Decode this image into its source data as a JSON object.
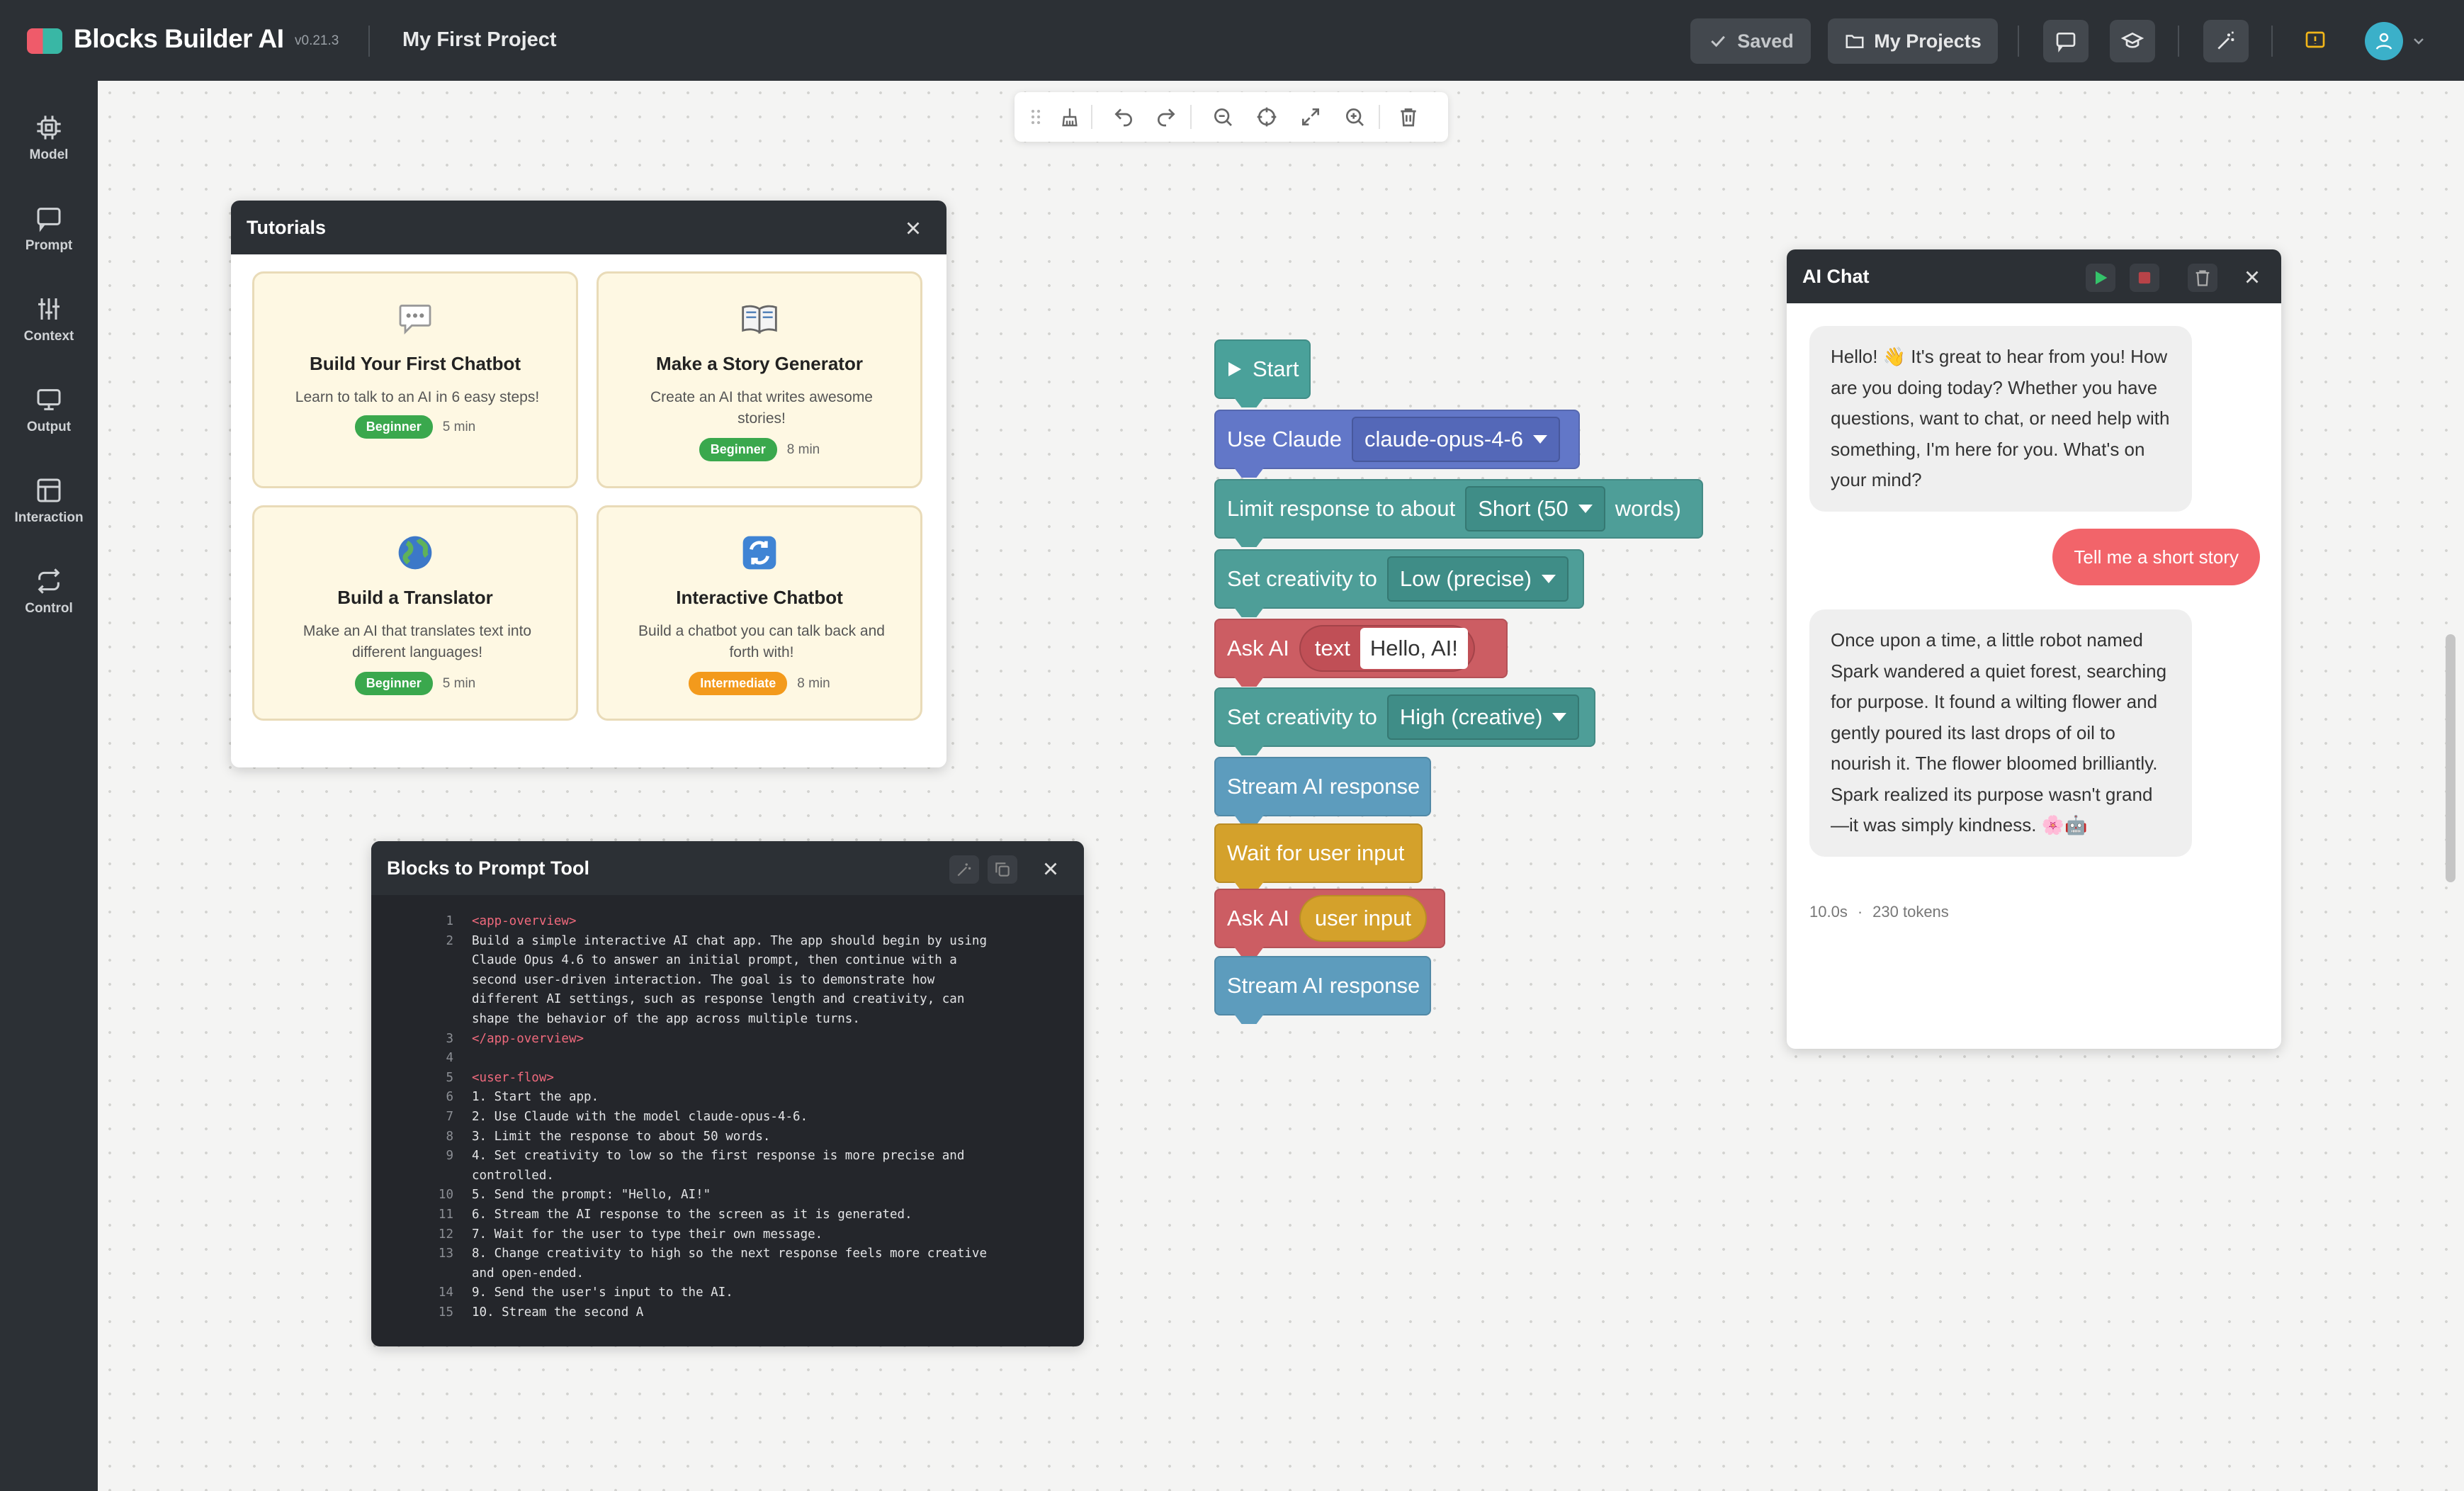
{
  "app": {
    "name": "Blocks Builder AI",
    "version": "v0.21.3",
    "project_name": "My First Project"
  },
  "topbar": {
    "saved_label": "Saved",
    "projects_label": "My Projects"
  },
  "sidebar": {
    "items": [
      {
        "label": "Model",
        "icon": "chip-icon"
      },
      {
        "label": "Prompt",
        "icon": "message-icon"
      },
      {
        "label": "Context",
        "icon": "sliders-icon"
      },
      {
        "label": "Output",
        "icon": "monitor-icon"
      },
      {
        "label": "Interaction",
        "icon": "layout-icon"
      },
      {
        "label": "Control",
        "icon": "repeat-icon"
      }
    ]
  },
  "tutorials": {
    "title": "Tutorials",
    "cards": [
      {
        "title": "Build Your First Chatbot",
        "desc": "Learn to talk to an AI in 6 easy steps!",
        "level": "Beginner",
        "time": "5 min",
        "icon": "speech-bubble-icon"
      },
      {
        "title": "Make a Story Generator",
        "desc": "Create an AI that writes awesome stories!",
        "level": "Beginner",
        "time": "8 min",
        "icon": "book-icon"
      },
      {
        "title": "Build a Translator",
        "desc": "Make an AI that translates text into different languages!",
        "level": "Beginner",
        "time": "5 min",
        "icon": "globe-icon"
      },
      {
        "title": "Interactive Chatbot",
        "desc": "Build a chatbot you can talk back and forth with!",
        "level": "Intermediate",
        "time": "8 min",
        "icon": "cycle-arrows-icon"
      }
    ]
  },
  "blocks_to_prompt": {
    "title": "Blocks to Prompt Tool",
    "lines": [
      {
        "num": "1",
        "text": "<app-overview>"
      },
      {
        "num": "2",
        "text": "Build a simple interactive AI chat app. The app should begin by using"
      },
      {
        "num": "",
        "text": "Claude Opus 4.6 to answer an initial prompt, then continue with a"
      },
      {
        "num": "",
        "text": "second user-driven interaction. The goal is to demonstrate how"
      },
      {
        "num": "",
        "text": "different AI settings, such as response length and creativity, can"
      },
      {
        "num": "",
        "text": "shape the behavior of the app across multiple turns."
      },
      {
        "num": "3",
        "text": "</app-overview>"
      },
      {
        "num": "4",
        "text": ""
      },
      {
        "num": "5",
        "text": "<user-flow>"
      },
      {
        "num": "6",
        "text": "1. Start the app."
      },
      {
        "num": "7",
        "text": "2. Use Claude with the model claude-opus-4-6."
      },
      {
        "num": "8",
        "text": "3. Limit the response to about 50 words."
      },
      {
        "num": "9",
        "text": "4. Set creativity to low so the first response is more precise and"
      },
      {
        "num": "",
        "text": "controlled."
      },
      {
        "num": "10",
        "text": "5. Send the prompt: \"Hello, AI!\""
      },
      {
        "num": "11",
        "text": "6. Stream the AI response to the screen as it is generated."
      },
      {
        "num": "12",
        "text": "7. Wait for the user to type their own message."
      },
      {
        "num": "13",
        "text": "8. Change creativity to high so the next response feels more creative"
      },
      {
        "num": "",
        "text": "and open-ended."
      },
      {
        "num": "14",
        "text": "9. Send the user's input to the AI."
      },
      {
        "num": "15",
        "text": "10. Stream the second A"
      }
    ]
  },
  "blocks": {
    "start": "Start",
    "use_claude": "Use Claude",
    "model_value": "claude-opus-4-6",
    "limit_prefix": "Limit response to about",
    "limit_value": "Short (50",
    "limit_suffix": "words)",
    "creativity_label": "Set creativity to",
    "creativity_low": "Low (precise)",
    "ask_ai": "Ask AI",
    "text_label": "text",
    "prompt_value": "Hello, AI!",
    "creativity_high": "High (creative)",
    "stream": "Stream AI response",
    "wait": "Wait for user input",
    "user_input": "user input"
  },
  "ai_chat": {
    "title": "AI Chat",
    "messages": [
      {
        "role": "ai",
        "text": "Hello! 👋 It's great to hear from you! How are you doing today? Whether you have questions, want to chat, or need help with something, I'm here for you. What's on your mind?"
      },
      {
        "role": "user",
        "text": "Tell me a short story"
      },
      {
        "role": "ai",
        "text": "Once upon a time, a little robot named Spark wandered a quiet forest, searching for purpose. It found a wilting flower and gently poured its last drops of oil to nourish it. The flower bloomed brilliantly. Spark realized its purpose wasn't grand—it was simply kindness. 🌸🤖"
      }
    ],
    "duration": "10.0s",
    "separator": "·",
    "tokens": "230 tokens"
  },
  "colors": {
    "topbar": "#2c3035",
    "accent_red": "#ef5b6a",
    "accent_teal": "#39b7a5",
    "beginner": "#3aa84d",
    "intermediate": "#f39a1c",
    "user_bubble": "#f2646a"
  }
}
